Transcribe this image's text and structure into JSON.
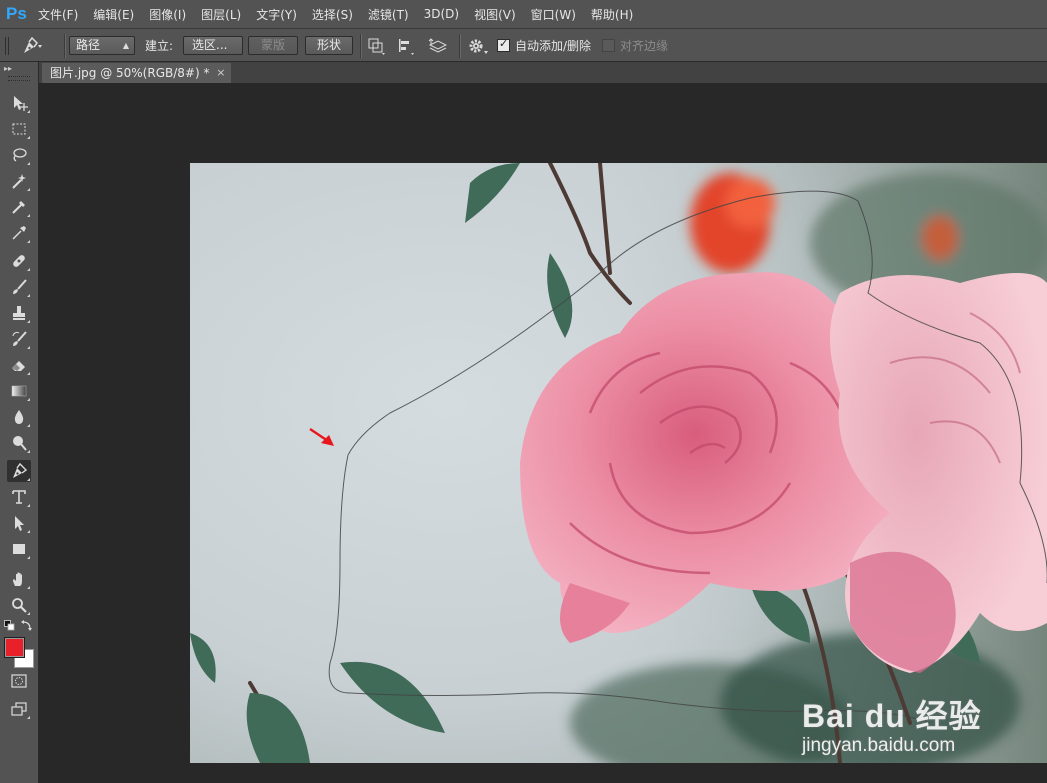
{
  "app": {
    "logo": "Ps"
  },
  "menu": [
    "文件(F)",
    "编辑(E)",
    "图像(I)",
    "图层(L)",
    "文字(Y)",
    "选择(S)",
    "滤镜(T)",
    "3D(D)",
    "视图(V)",
    "窗口(W)",
    "帮助(H)"
  ],
  "options": {
    "tool_icon": "pen-icon",
    "mode_select": "路径",
    "make_label": "建立:",
    "selection_button": "选区...",
    "mask_button": "蒙版",
    "shape_button": "形状",
    "auto_add_delete": {
      "label": "自动添加/删除",
      "checked": true
    },
    "align_edges": {
      "label": "对齐边缘",
      "checked": false
    }
  },
  "tab": {
    "title": "图片.jpg @ 50%(RGB/8#) *",
    "close": "×"
  },
  "tools": [
    {
      "name": "move-tool",
      "icon": "move-icon"
    },
    {
      "name": "marquee-tool",
      "icon": "marquee-icon"
    },
    {
      "name": "lasso-tool",
      "icon": "lasso-icon"
    },
    {
      "name": "magic-wand-tool",
      "icon": "magic-wand-icon"
    },
    {
      "name": "crop-tool",
      "icon": "crop-icon"
    },
    {
      "name": "eyedropper-tool",
      "icon": "eyedropper-icon"
    },
    {
      "name": "healing-brush-tool",
      "icon": "bandage-icon"
    },
    {
      "name": "brush-tool",
      "icon": "brush-icon"
    },
    {
      "name": "stamp-tool",
      "icon": "stamp-icon"
    },
    {
      "name": "history-brush-tool",
      "icon": "history-brush-icon"
    },
    {
      "name": "eraser-tool",
      "icon": "eraser-icon"
    },
    {
      "name": "gradient-tool",
      "icon": "gradient-icon"
    },
    {
      "name": "blur-tool",
      "icon": "droplet-icon"
    },
    {
      "name": "dodge-tool",
      "icon": "dodge-icon"
    },
    {
      "name": "pen-tool",
      "icon": "pen-icon",
      "active": true
    },
    {
      "name": "type-tool",
      "icon": "type-icon"
    },
    {
      "name": "path-selection-tool",
      "icon": "arrow-select-icon"
    },
    {
      "name": "rectangle-tool",
      "icon": "rectangle-icon"
    },
    {
      "name": "hand-tool",
      "icon": "hand-icon"
    },
    {
      "name": "zoom-tool",
      "icon": "zoom-icon"
    }
  ],
  "colors": {
    "foreground": "#e8202a",
    "background": "#ffffff",
    "app_bg": "#535353",
    "canvas_bg": "#282828"
  },
  "watermark": {
    "brand": "Bai du 经验",
    "url": "jingyan.baidu.com"
  }
}
